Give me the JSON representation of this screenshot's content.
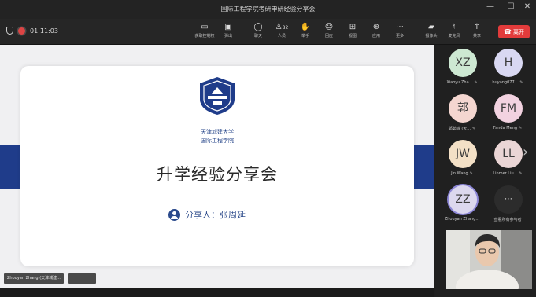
{
  "window": {
    "title": "国际工程学院考研申研经验分享会",
    "minimize_icon": "—",
    "maximize_icon": "☐",
    "close_icon": "✕"
  },
  "toolbar": {
    "timer": "01:11:03",
    "buttons": [
      {
        "icon": "▭",
        "label": "获取控制权"
      },
      {
        "icon": "▣",
        "label": "弹出"
      },
      {
        "icon": "◯",
        "label": "聊天"
      },
      {
        "icon": "♙",
        "label": "人员",
        "count": "82"
      },
      {
        "icon": "✋",
        "label": "举手"
      },
      {
        "icon": "☺",
        "label": "回应"
      },
      {
        "icon": "⊞",
        "label": "视图"
      },
      {
        "icon": "⊕",
        "label": "应用"
      },
      {
        "icon": "⋯",
        "label": "更多"
      },
      {
        "icon": "▰",
        "label": "摄像头"
      },
      {
        "icon": "♮",
        "label": "麦克风"
      },
      {
        "icon": "↑",
        "label": "共享"
      }
    ],
    "leave_label": "离开",
    "leave_icon": "☎",
    "leave_color": "#e23b3b"
  },
  "slide": {
    "school_name_1": "天津城建大学",
    "school_name_2": "国际工程学院",
    "title": "升学经验分享会",
    "presenter": "分享人：张周延",
    "accent_color": "#1f3c8a"
  },
  "stage_labels": {
    "sharer_name": "Zhouyan Zhang (天津城建...",
    "secondary": "⋮"
  },
  "participants": [
    {
      "initials": "XZ",
      "name": "Xiaoyu Zha...",
      "color": "#cde8d2"
    },
    {
      "initials": "H",
      "name": "huyang077...",
      "color": "#d9d8f2"
    },
    {
      "initials": "郭",
      "name": "郭茹锦 (天...",
      "color": "#f4d6d0"
    },
    {
      "initials": "FM",
      "name": "Fanda Meng",
      "color": "#f2d2e0"
    },
    {
      "initials": "JW",
      "name": "Jin Wang",
      "color": "#f3e0c6"
    },
    {
      "initials": "LL",
      "name": "Linmer Liu...",
      "color": "#ead5d5"
    },
    {
      "initials": "ZZ",
      "name": "Zhouyan Zhang...",
      "color": "#dcd8ee"
    },
    {
      "initials": "⋯",
      "name": "查看所有参与者",
      "color": "#2c2c2c"
    }
  ]
}
